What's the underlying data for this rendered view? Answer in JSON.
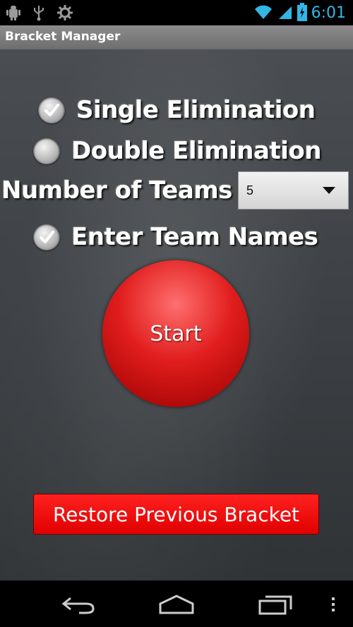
{
  "status_bar": {
    "time": "6:01",
    "left_icons": [
      "android-debug-icon",
      "usb-icon",
      "settings-gear-icon"
    ],
    "right_icons": [
      "wifi-icon",
      "cell-signal-icon",
      "battery-charging-icon"
    ]
  },
  "app": {
    "title": "Bracket Manager"
  },
  "options": {
    "single_elimination": {
      "label": "Single Elimination",
      "checked": true
    },
    "double_elimination": {
      "label": "Double Elimination",
      "checked": false
    },
    "number_of_teams": {
      "label": "Number of Teams",
      "value": "5"
    },
    "enter_team_names": {
      "label": "Enter Team Names",
      "checked": true
    }
  },
  "buttons": {
    "start": "Start",
    "restore": "Restore Previous Bracket"
  },
  "nav": {
    "icons": [
      "back-icon",
      "home-icon",
      "recent-apps-icon",
      "menu-overflow-icon"
    ]
  },
  "colors": {
    "status_accent": "#33b5e5",
    "start_red": "#e11d1d",
    "restore_red": "#ff0000"
  }
}
